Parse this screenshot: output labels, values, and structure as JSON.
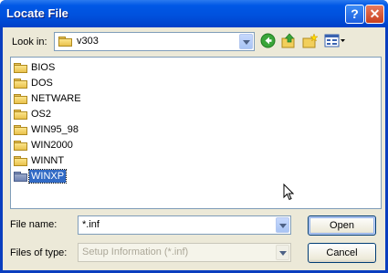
{
  "window": {
    "title": "Locate File"
  },
  "look_in": {
    "label": "Look in:",
    "value": "v303"
  },
  "folders": [
    "BIOS",
    "DOS",
    "NETWARE",
    "OS2",
    "WIN95_98",
    "WIN2000",
    "WINNT",
    "WINXP"
  ],
  "selected_folder": "WINXP",
  "file_name": {
    "label": "File name:",
    "value": "*.inf"
  },
  "files_of_type": {
    "label": "Files of type:",
    "value": "Setup Information (*.inf)"
  },
  "buttons": {
    "open": "Open",
    "cancel": "Cancel",
    "help": "?",
    "close": "✕"
  },
  "colors": {
    "titlebar": "#0054e3",
    "selection": "#316ac5",
    "dialog_bg": "#ece9d8"
  }
}
